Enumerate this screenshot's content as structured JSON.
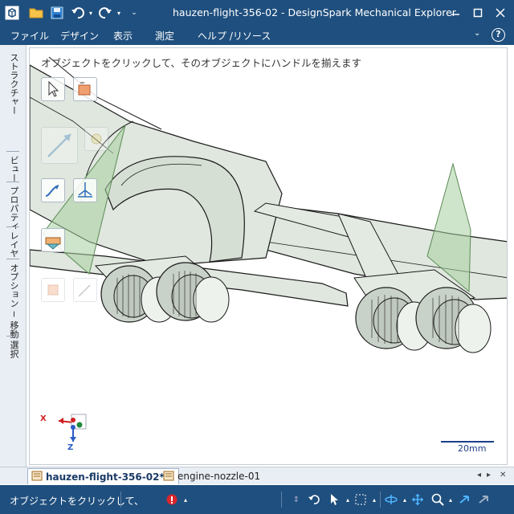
{
  "window": {
    "title": "hauzen-flight-356-02 - DesignSpark Mechanical Explorer",
    "minimize_icon": "minimize-icon",
    "maximize_icon": "maximize-icon",
    "close_icon": "close-icon"
  },
  "quick_access": {
    "icons": [
      "app-logo-icon",
      "open-folder-icon",
      "save-icon",
      "undo-icon",
      "redo-icon",
      "customize-dropdown-icon"
    ]
  },
  "menu": {
    "items": [
      "ファイル",
      "デザイン",
      "表示",
      "測定",
      "ヘルプ /リソース"
    ],
    "help_icon": "help-icon"
  },
  "left_tabs": [
    "ストラクチャー",
    "ビュー",
    "プロパティ",
    "レイヤ",
    "オプション − 移動",
    "選択"
  ],
  "viewport": {
    "hint": "オブジェクトをクリックして、そのオブジェクトにハンドルを揃えます",
    "scale_label": "20mm",
    "axes": {
      "x": "X",
      "z": "Z"
    }
  },
  "tabs": {
    "active": "hauzen-flight-356-02*",
    "second": "engine-nozzle-01",
    "close": "✕"
  },
  "status": {
    "message": "オブジェクトをクリックして、"
  },
  "colors": {
    "chrome": "#1f4f7e",
    "panel": "#e9eef4",
    "model_fill": "#dfe7de",
    "model_edge": "#1a1a1a",
    "handle_fill": "#a8cfa0",
    "scale": "#1e3f8a"
  }
}
